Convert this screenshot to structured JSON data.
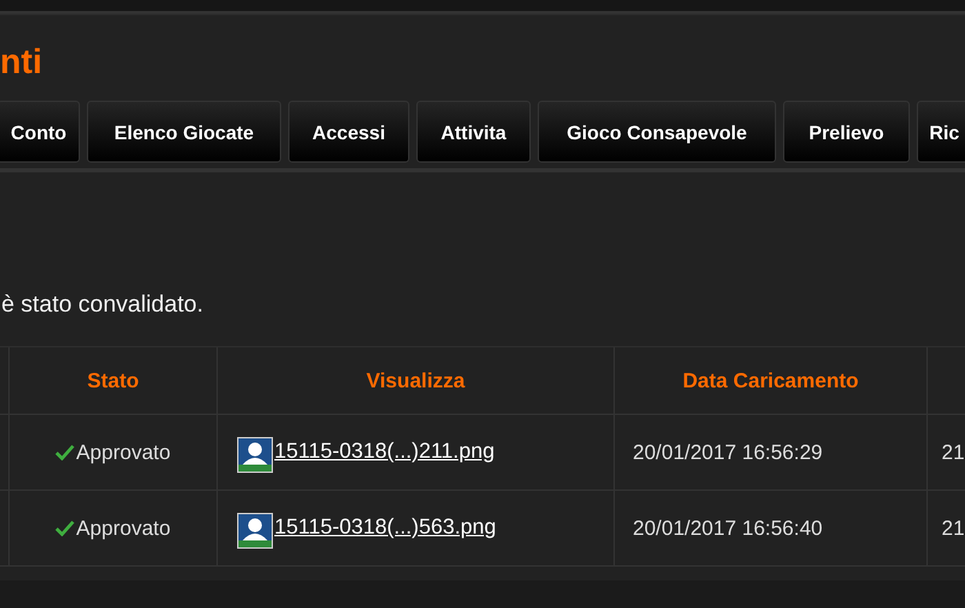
{
  "page_title": "nti",
  "tabs": [
    {
      "label": "Conto",
      "selected": false
    },
    {
      "label": "Elenco Giocate",
      "selected": false
    },
    {
      "label": "Accessi",
      "selected": false
    },
    {
      "label": "Attivita",
      "selected": false
    },
    {
      "label": "Gioco Consapevole",
      "selected": false
    },
    {
      "label": "Prelievo",
      "selected": false
    },
    {
      "label": "Ric",
      "selected": false
    }
  ],
  "message": "è stato convalidato.",
  "table": {
    "columns": [
      "Stato",
      "Visualizza",
      "Data Caricamento"
    ],
    "rows": [
      {
        "status": "Approvato",
        "approved": true,
        "file": "15115-0318(...)211.png",
        "date": "20/01/2017 16:56:29",
        "column_5": "21"
      },
      {
        "status": "Approvato",
        "approved": true,
        "file": "15115-0318(...)563.png",
        "date": "20/01/2017 16:56:40",
        "column_5": "21"
      }
    ]
  }
}
